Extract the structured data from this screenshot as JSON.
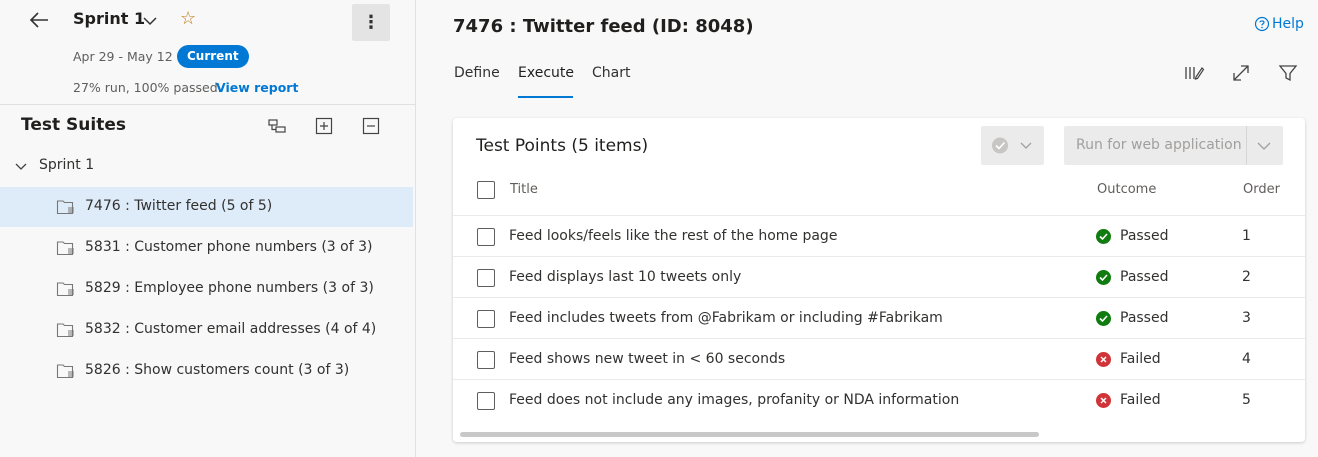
{
  "sprint": {
    "title": "Sprint 1",
    "dates": "Apr 29 - May 12",
    "badge": "Current",
    "run_stats": "27% run, 100% passed.",
    "report_link": "View report"
  },
  "suites": {
    "heading": "Test Suites",
    "root_label": "Sprint 1",
    "items": [
      {
        "label": "7476 : Twitter feed  (5 of 5)",
        "selected": true
      },
      {
        "label": "5831 : Customer phone numbers  (3 of 3)",
        "selected": false
      },
      {
        "label": "5829 : Employee phone numbers  (3 of 3)",
        "selected": false
      },
      {
        "label": "5832 : Customer email addresses  (4 of 4)",
        "selected": false
      },
      {
        "label": "5826 : Show customers count  (3 of 3)",
        "selected": false
      }
    ]
  },
  "main": {
    "title": "7476 : Twitter feed (ID: 8048)",
    "help": "Help",
    "tabs": [
      {
        "label": "Define",
        "active": false
      },
      {
        "label": "Execute",
        "active": true
      },
      {
        "label": "Chart",
        "active": false
      }
    ]
  },
  "test_points": {
    "title": "Test Points (5 items)",
    "run_button": "Run for web application",
    "columns": {
      "title": "Title",
      "outcome": "Outcome",
      "order": "Order"
    },
    "rows": [
      {
        "title": "Feed looks/feels like the rest of the home page",
        "outcome": "Passed",
        "status": "pass",
        "order": "1"
      },
      {
        "title": "Feed displays last 10 tweets only",
        "outcome": "Passed",
        "status": "pass",
        "order": "2"
      },
      {
        "title": "Feed includes tweets from @Fabrikam or including #Fabrikam",
        "outcome": "Passed",
        "status": "pass",
        "order": "3"
      },
      {
        "title": "Feed shows new tweet in < 60 seconds",
        "outcome": "Failed",
        "status": "fail",
        "order": "4"
      },
      {
        "title": "Feed does not include any images, profanity or NDA information",
        "outcome": "Failed",
        "status": "fail",
        "order": "5"
      }
    ]
  },
  "colors": {
    "accent": "#0078d4",
    "passed": "#107c10",
    "failed": "#d13438",
    "selected_row": "#deecf9",
    "star": "#c07b16"
  }
}
